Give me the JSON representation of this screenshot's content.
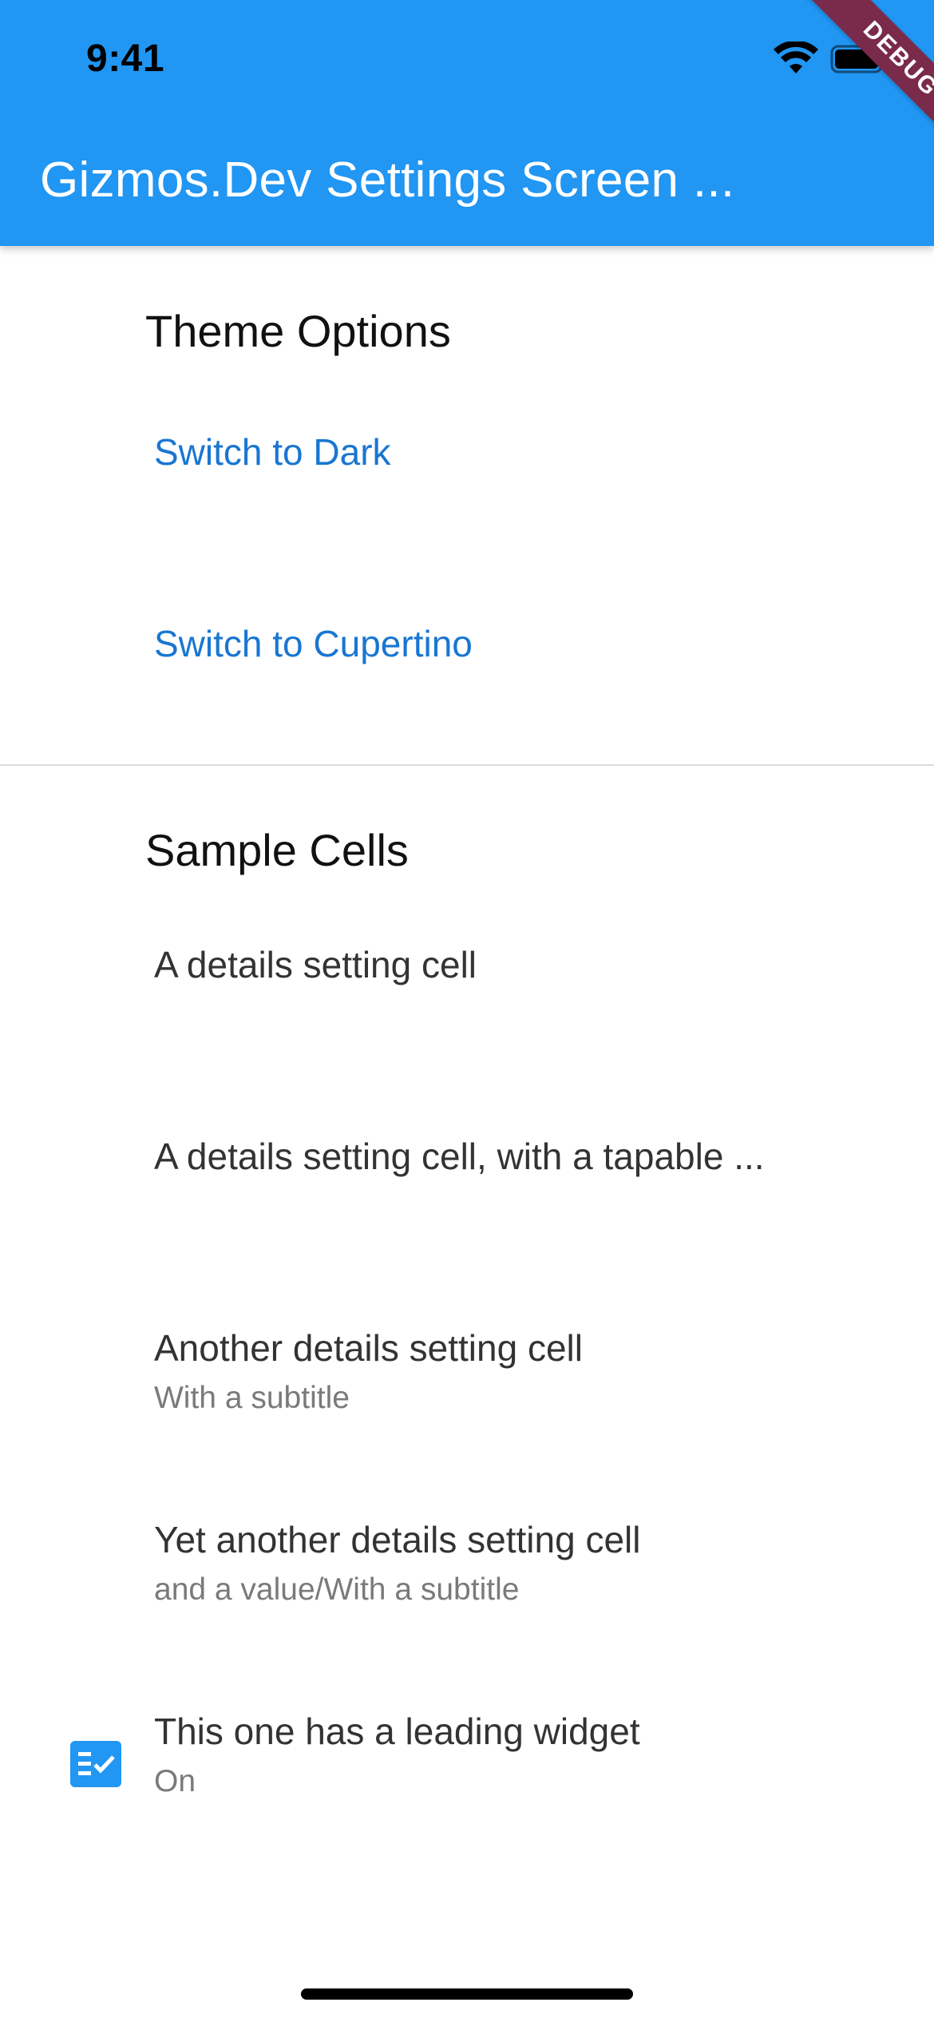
{
  "status_bar": {
    "time": "9:41",
    "icons": [
      "wifi-icon",
      "battery-icon"
    ]
  },
  "app_bar": {
    "title": "Gizmos.Dev Settings Screen ...",
    "background_color": "#2196F3"
  },
  "debug_ribbon": {
    "label": "DEBUG",
    "color": "#7a2a4a"
  },
  "sections": {
    "theme": {
      "title": "Theme Options",
      "items": [
        {
          "label": "Switch to Dark"
        },
        {
          "label": "Switch to Cupertino"
        }
      ]
    },
    "sample": {
      "title": "Sample Cells",
      "cells": [
        {
          "title": "A details setting cell"
        },
        {
          "title": "A details setting cell, with a tapable ..."
        },
        {
          "title": "Another details setting cell",
          "subtitle": "With a subtitle"
        },
        {
          "title": "Yet another details setting cell",
          "subtitle": "and a value/With a subtitle"
        },
        {
          "title": "This one has a leading widget",
          "subtitle": "On",
          "leading_icon": "checklist-icon"
        }
      ]
    }
  },
  "colors": {
    "link": "#1976D2",
    "accent": "#2196F3"
  }
}
